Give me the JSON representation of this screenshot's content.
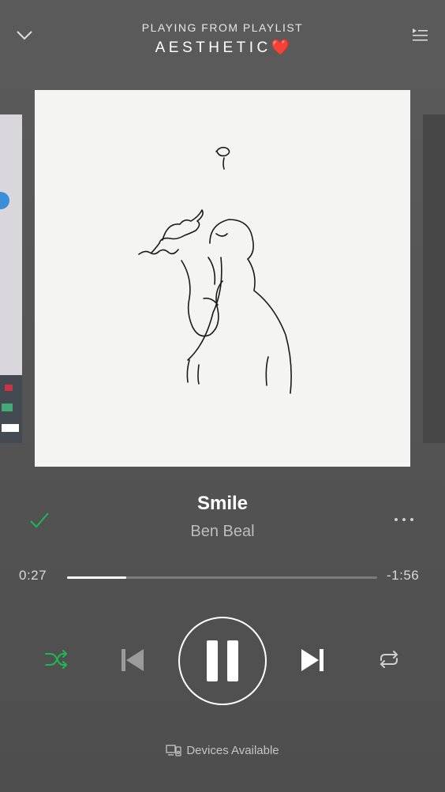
{
  "header": {
    "context_label": "PLAYING FROM PLAYLIST",
    "playlist_name": "AESTHETIC",
    "playlist_emoji": "❤️"
  },
  "track": {
    "title": "Smile",
    "artist": "Ben Beal",
    "liked": true
  },
  "progress": {
    "elapsed": "0:27",
    "remaining": "-1:56",
    "fraction": 0.19
  },
  "controls": {
    "shuffle_active": true,
    "playing": true,
    "accent_color": "#1db954"
  },
  "footer": {
    "devices_label": "Devices Available"
  },
  "icons": [
    "chevron-down-icon",
    "queue-icon",
    "check-icon",
    "more-icon",
    "shuffle-icon",
    "skip-previous-icon",
    "pause-icon",
    "skip-next-icon",
    "repeat-icon",
    "devices-icon"
  ]
}
